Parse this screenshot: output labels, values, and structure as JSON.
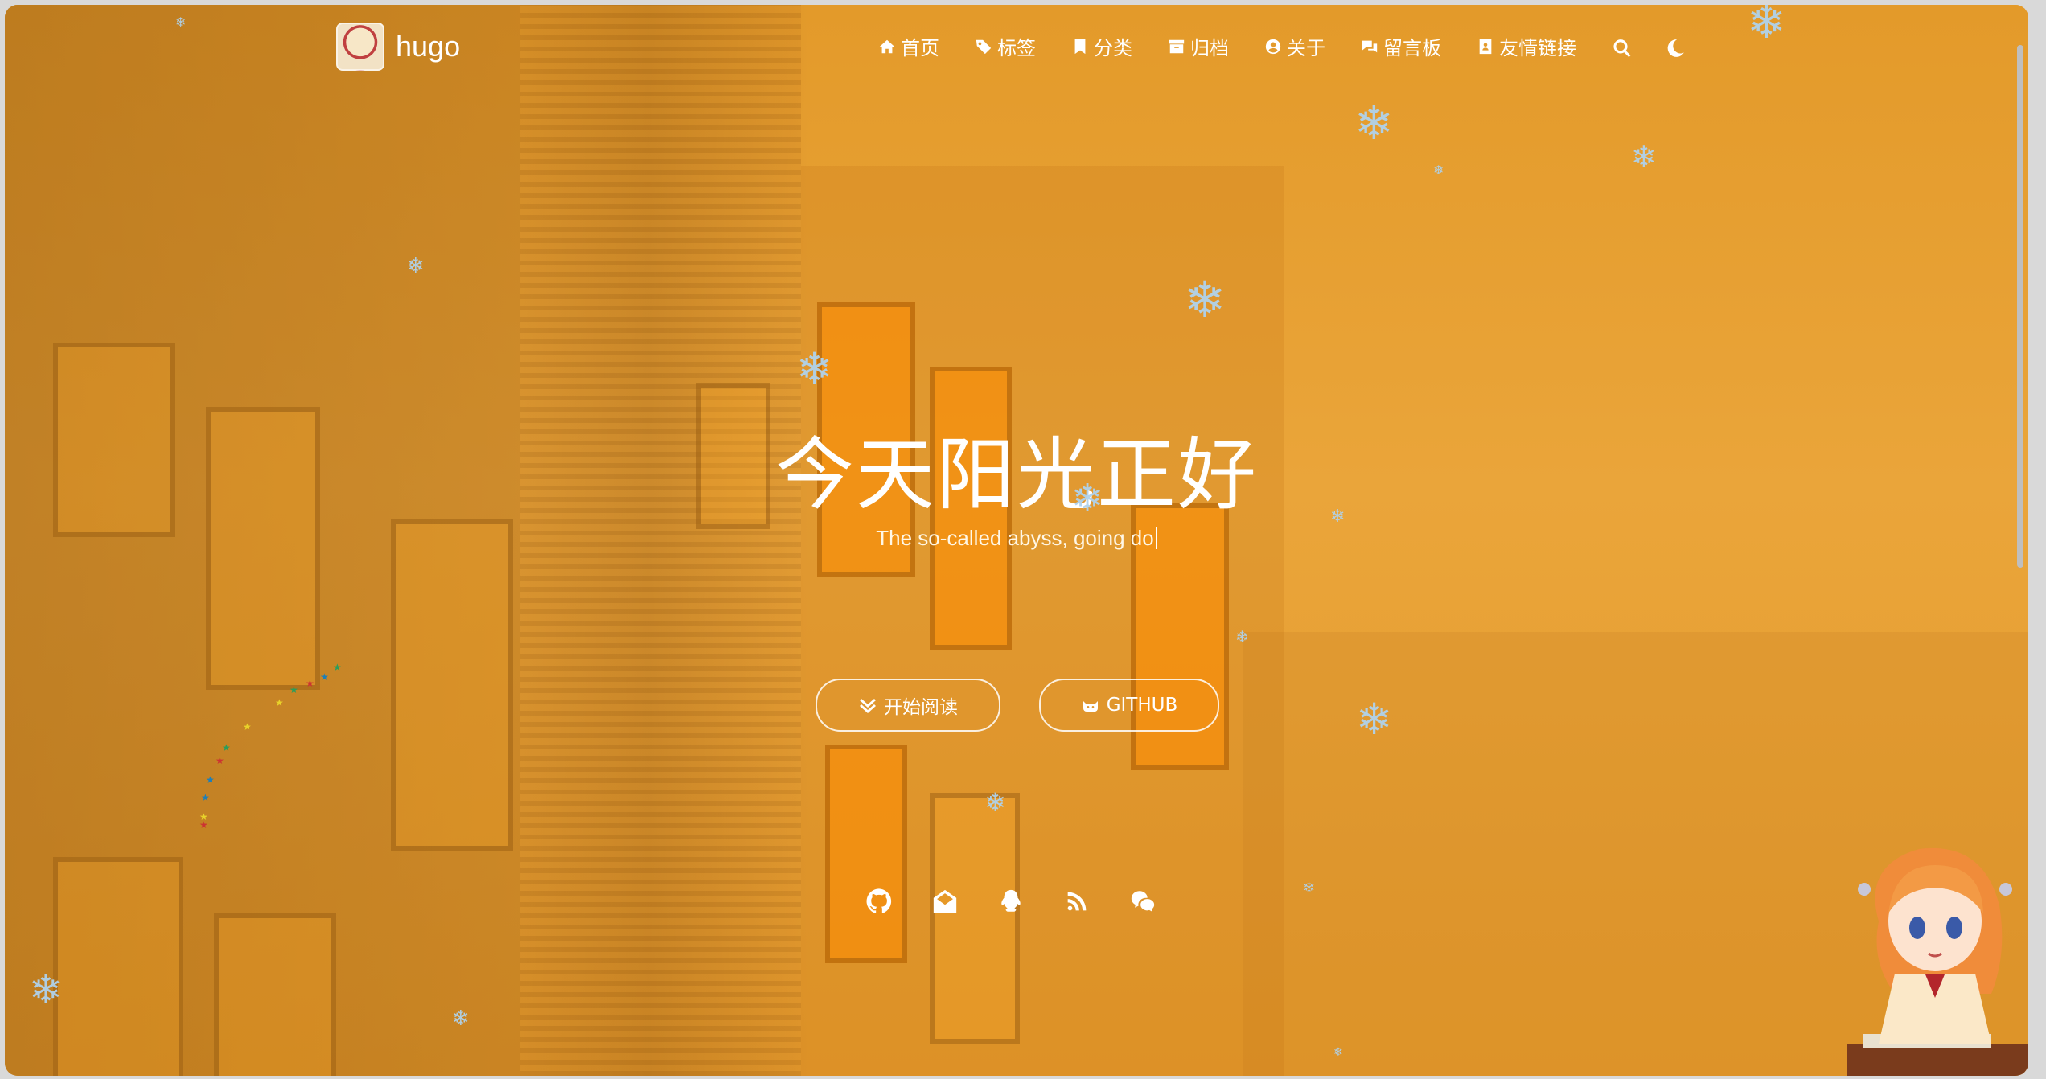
{
  "brand": {
    "name": "hugo"
  },
  "nav": {
    "items": [
      {
        "label": "首页",
        "icon": "home-icon"
      },
      {
        "label": "标签",
        "icon": "tags-icon"
      },
      {
        "label": "分类",
        "icon": "bookmark-icon"
      },
      {
        "label": "归档",
        "icon": "archive-icon"
      },
      {
        "label": "关于",
        "icon": "user-circle-icon"
      },
      {
        "label": "留言板",
        "icon": "comments-icon"
      },
      {
        "label": "友情链接",
        "icon": "address-book-icon"
      }
    ],
    "search_icon": "search-icon",
    "theme_icon": "moon-icon"
  },
  "hero": {
    "title": "今天阳光正好",
    "subtitle": "The so-called abyss, going do"
  },
  "buttons": {
    "read_label": "开始阅读",
    "github_label": "GITHUB"
  },
  "socials": [
    "github-icon",
    "email-icon",
    "qq-icon",
    "rss-icon",
    "wechat-icon"
  ],
  "colors": {
    "overlay": "#e9a335",
    "text": "#ffffff",
    "snowflake": "#afd2eb"
  }
}
